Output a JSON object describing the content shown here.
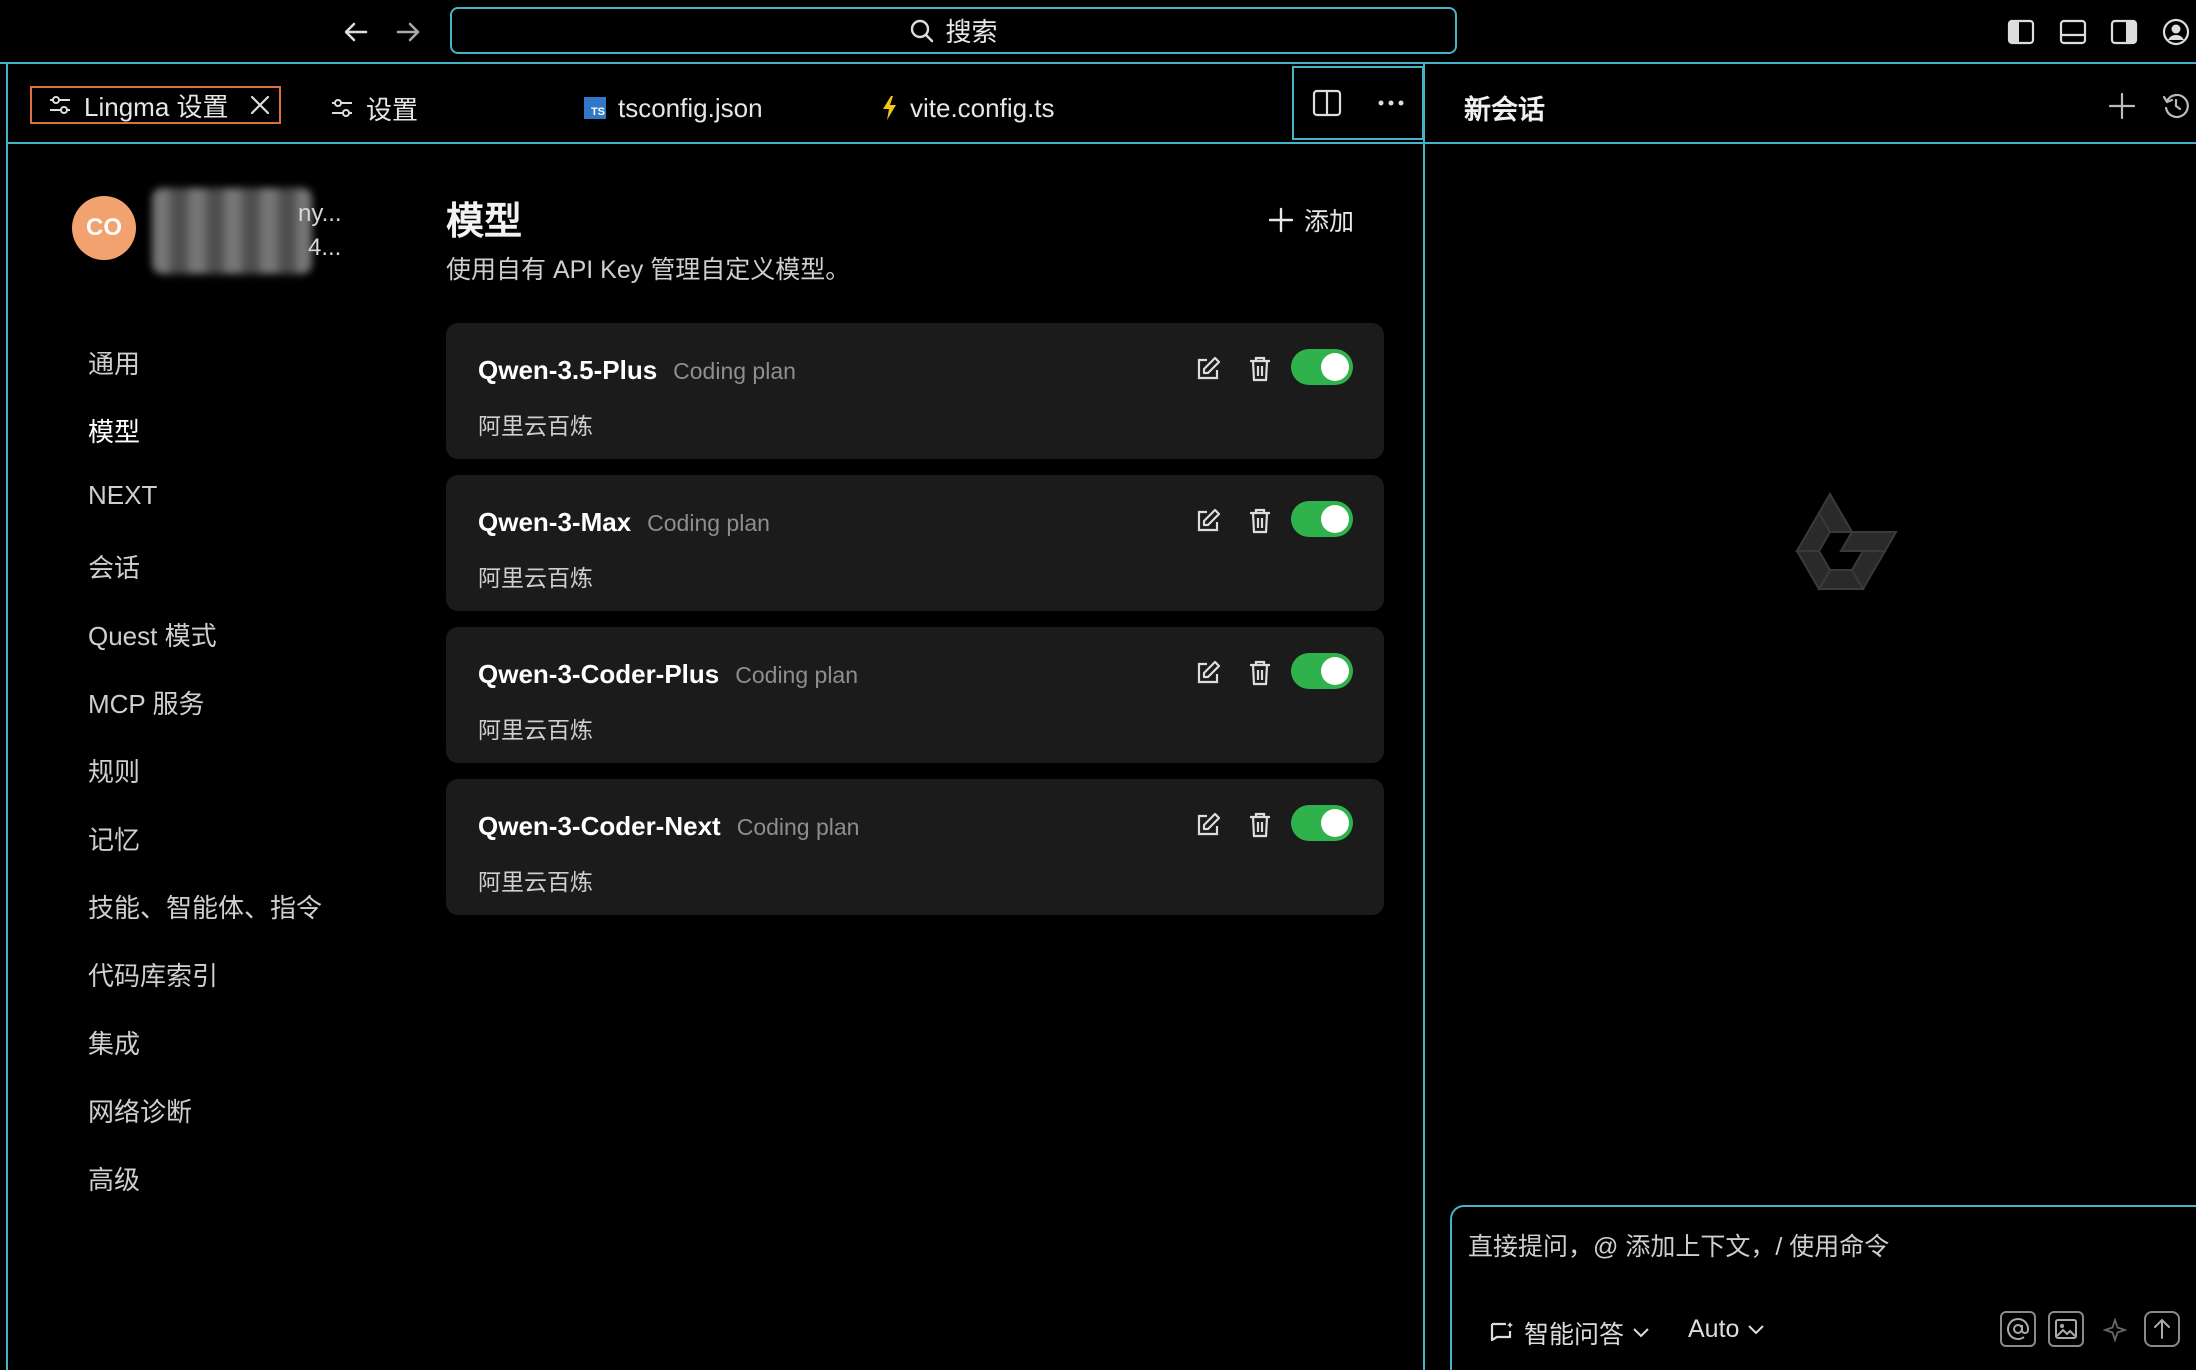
{
  "titlebar": {
    "search_label": "搜索",
    "back_icon": "arrow-left-icon",
    "forward_icon": "arrow-right-icon"
  },
  "tabs": [
    {
      "label": "Lingma 设置",
      "icon": "sliders-icon",
      "active": true
    },
    {
      "label": "设置",
      "icon": "sliders-icon"
    },
    {
      "label": "tsconfig.json",
      "icon": "typescript-file-icon"
    },
    {
      "label": "vite.config.ts",
      "icon": "vite-bolt-icon"
    }
  ],
  "user": {
    "avatar_initials": "CO",
    "name_suffix": "ny...",
    "id_suffix": "4..."
  },
  "sidebar": {
    "items": [
      {
        "label": "通用"
      },
      {
        "label": "模型",
        "active": true
      },
      {
        "label": "NEXT"
      },
      {
        "label": "会话"
      },
      {
        "label": "Quest 模式"
      },
      {
        "label": "MCP 服务"
      },
      {
        "label": "规则"
      },
      {
        "label": "记忆"
      },
      {
        "label": "技能、智能体、指令"
      },
      {
        "label": "代码库索引"
      },
      {
        "label": "集成"
      },
      {
        "label": "网络诊断"
      },
      {
        "label": "高级"
      }
    ]
  },
  "main": {
    "title": "模型",
    "description": "使用自有 API Key 管理自定义模型。",
    "add_label": "添加",
    "models": [
      {
        "name": "Qwen-3.5-Plus",
        "plan": "Coding plan",
        "provider": "阿里云百炼",
        "enabled": true
      },
      {
        "name": "Qwen-3-Max",
        "plan": "Coding plan",
        "provider": "阿里云百炼",
        "enabled": true
      },
      {
        "name": "Qwen-3-Coder-Plus",
        "plan": "Coding plan",
        "provider": "阿里云百炼",
        "enabled": true
      },
      {
        "name": "Qwen-3-Coder-Next",
        "plan": "Coding plan",
        "provider": "阿里云百炼",
        "enabled": true
      }
    ]
  },
  "chat": {
    "title": "新会话",
    "input_placeholder": "直接提问，@ 添加上下文，/ 使用命令",
    "mode_label": "智能问答",
    "model_label": "Auto"
  },
  "colors": {
    "frame": "#46b4c8",
    "active_tab_border": "#e0703a",
    "toggle_on": "#2fb24c",
    "avatar": "#f1a26e"
  }
}
